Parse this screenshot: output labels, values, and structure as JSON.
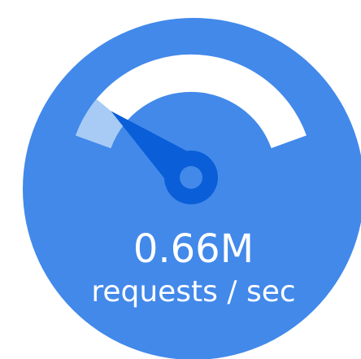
{
  "gauge": {
    "value_label": "0.66M",
    "unit_label": "requests / sec",
    "level": 0.14,
    "colors": {
      "dial": "#4289ea",
      "track": "#ffffff",
      "fill": "#a7cbf5",
      "needle": "#0a5ed8",
      "hub_center": "#4289ea",
      "text": "#ffffff"
    }
  }
}
